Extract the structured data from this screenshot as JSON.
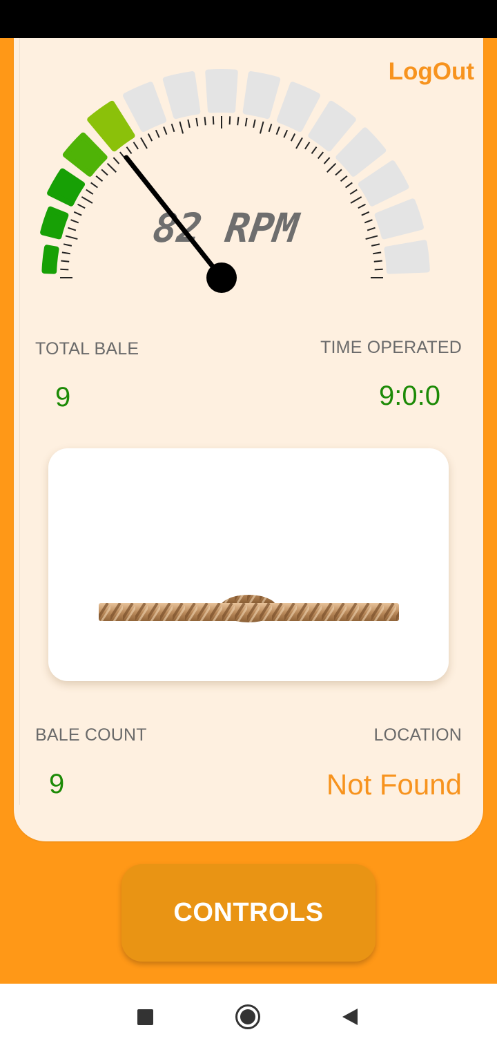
{
  "header": {
    "logout_label": "LogOut"
  },
  "gauge": {
    "rpm_label": "82 RPM",
    "rpm_value": 82,
    "active_segments": 5,
    "total_segments": 15,
    "colors": {
      "active_dark": "#17A005",
      "active_light": "#8BC10A",
      "inactive": "#E4E4E4"
    }
  },
  "stats": {
    "total_bale_label": "TOTAL BALE",
    "total_bale_value": "9",
    "time_operated_label": "TIME OPERATED",
    "time_operated_value": "9:0:0",
    "bale_count_label": "BALE COUNT",
    "bale_count_value": "9",
    "location_label": "LOCATION",
    "location_value": "Not Found"
  },
  "controls": {
    "label": "CONTROLS"
  },
  "nav": {
    "icons": [
      "recents-square-icon",
      "home-circle-icon",
      "back-triangle-icon"
    ]
  },
  "colors": {
    "accent": "#FF9817",
    "card": "#FEF0E0",
    "value_green": "#1c8a06",
    "orange_text": "#F7931E"
  }
}
